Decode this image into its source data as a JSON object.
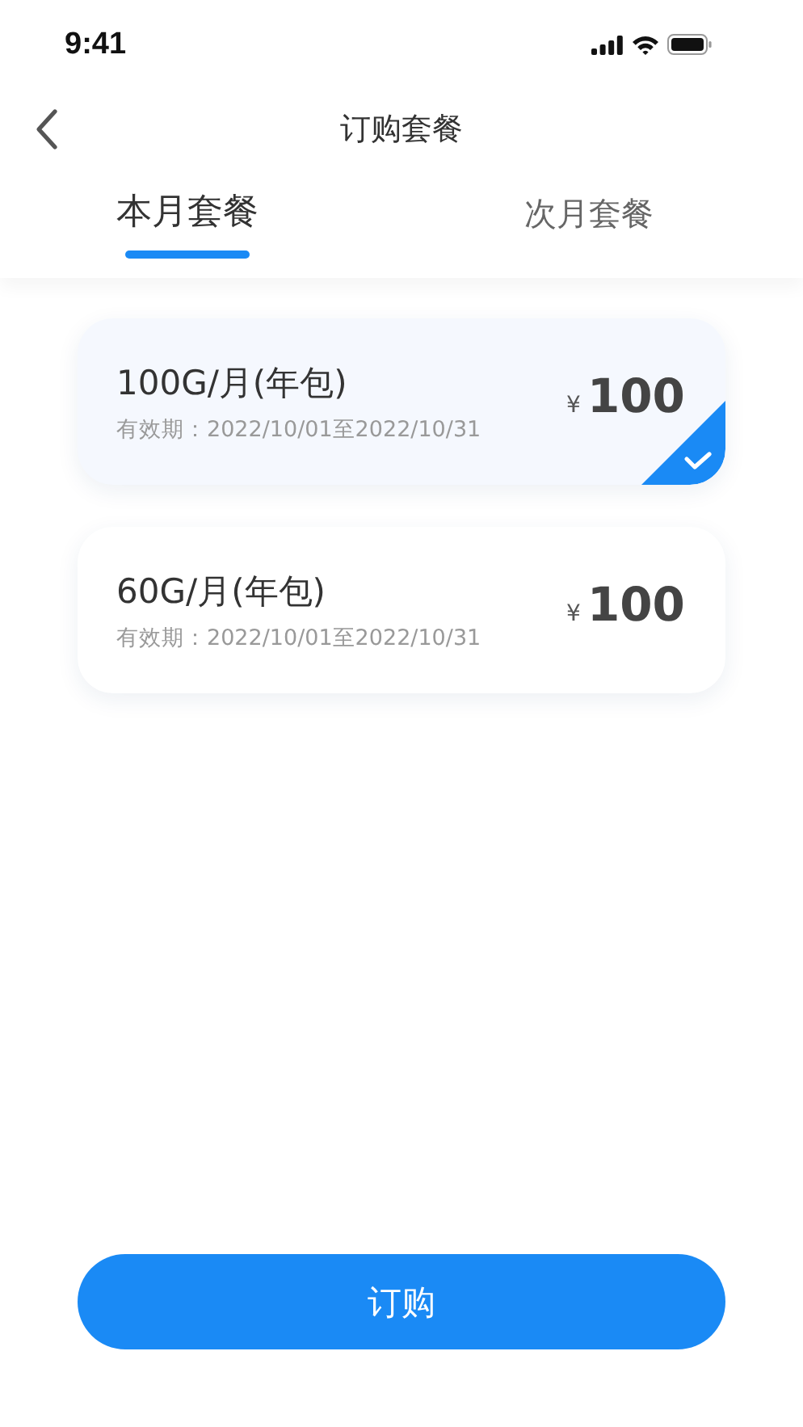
{
  "status_bar": {
    "time": "9:41"
  },
  "nav": {
    "title": "订购套餐"
  },
  "tabs": [
    {
      "label": "本月套餐",
      "selected": true
    },
    {
      "label": "次月套餐",
      "selected": false
    }
  ],
  "plans": [
    {
      "name": "100G/月(年包)",
      "validity": "有效期：2022/10/01至2022/10/31",
      "currency": "¥",
      "price": "100",
      "selected": true
    },
    {
      "name": "60G/月(年包)",
      "validity": "有效期：2022/10/01至2022/10/31",
      "currency": "¥",
      "price": "100",
      "selected": false
    }
  ],
  "button": {
    "label": "订购"
  }
}
